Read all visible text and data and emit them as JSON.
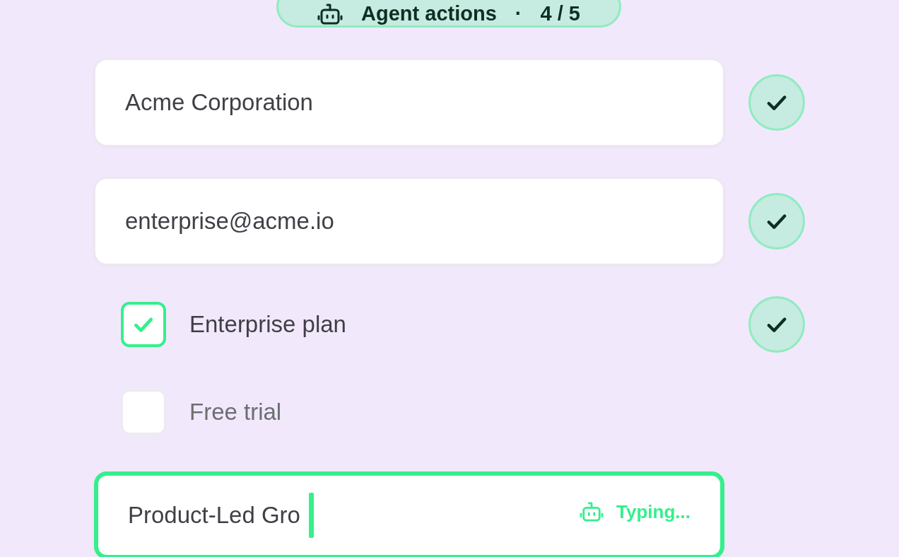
{
  "header": {
    "title": "Agent actions",
    "separator": "·",
    "progress": "4 / 5"
  },
  "items": [
    {
      "kind": "field",
      "value": "Acme Corporation",
      "done": true
    },
    {
      "kind": "field",
      "value": "enterprise@acme.io",
      "done": true
    },
    {
      "kind": "checkbox",
      "label": "Enterprise plan",
      "checked": true,
      "done": true
    },
    {
      "kind": "checkbox",
      "label": "Free trial",
      "checked": false,
      "done": false
    },
    {
      "kind": "typing",
      "value": "Product-Led Gro",
      "status": "Typing...",
      "done": false
    }
  ]
}
